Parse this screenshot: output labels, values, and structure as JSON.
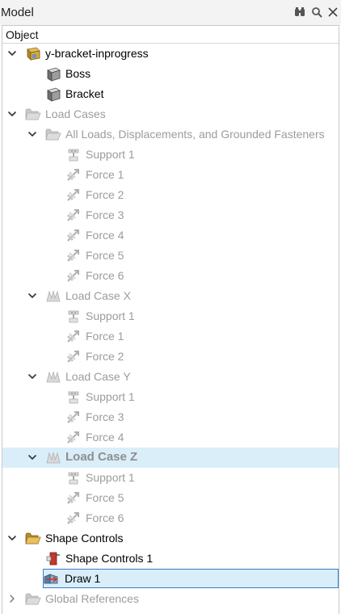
{
  "panel": {
    "title": "Model",
    "column_header": "Object",
    "tools": [
      "binoculars-icon",
      "search-icon",
      "close-icon"
    ]
  },
  "tree": {
    "root": "y-bracket-inprogress",
    "parts": [
      "Boss",
      "Bracket"
    ],
    "load_cases_folder": "Load Cases",
    "all_loads": "All Loads, Displacements, and Grounded Fasteners",
    "all_loads_items": [
      "Support 1",
      "Force 1",
      "Force 2",
      "Force 3",
      "Force 4",
      "Force 5",
      "Force 6"
    ],
    "lcx": "Load Case X",
    "lcx_items": [
      "Support 1",
      "Force 1",
      "Force 2"
    ],
    "lcy": "Load Case Y",
    "lcy_items": [
      "Support 1",
      "Force 3",
      "Force 4"
    ],
    "lcz": "Load Case Z",
    "lcz_items": [
      "Support 1",
      "Force 5",
      "Force 6"
    ],
    "shape_controls_folder": "Shape Controls",
    "shape_controls_1": "Shape Controls 1",
    "draw_1": "Draw 1",
    "global_references": "Global References"
  },
  "colors": {
    "selection": "#d9eef9",
    "focus_border": "#3a7bc4",
    "dim_text": "#9c9c9c"
  }
}
